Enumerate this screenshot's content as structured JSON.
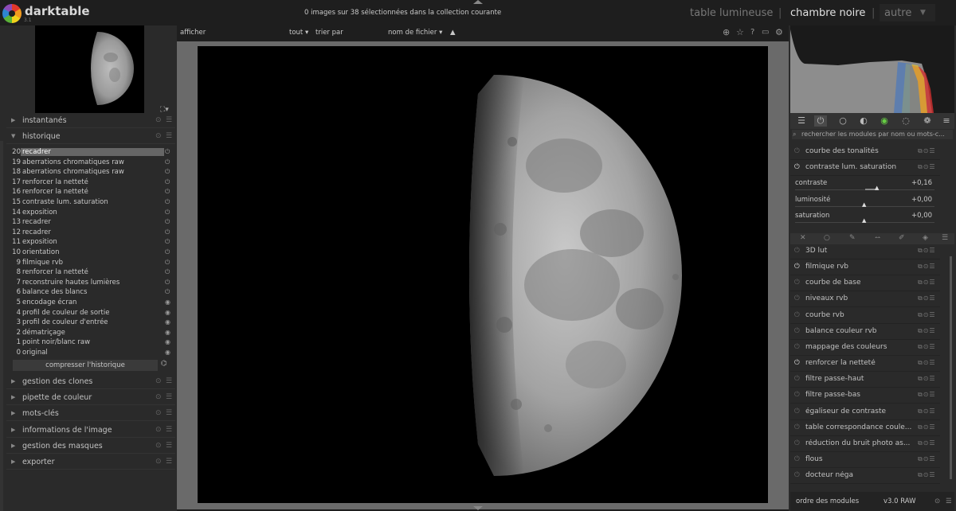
{
  "app": {
    "name": "darktable",
    "version": "3.1"
  },
  "header": {
    "collection_info": "0 images sur 38 sélectionnées dans la collection courante",
    "views": {
      "lighttable": "table lumineuse",
      "darkroom": "chambre noire",
      "other": "autre",
      "separator": "|"
    }
  },
  "left": {
    "sections_top": [
      {
        "label": "instantanés",
        "arrow": "▶"
      },
      {
        "label": "historique",
        "arrow": "▼"
      }
    ],
    "history": [
      {
        "num": "20",
        "name": "recadrer",
        "active": true
      },
      {
        "num": "19",
        "name": "aberrations chromatiques raw"
      },
      {
        "num": "18",
        "name": "aberrations chromatiques raw"
      },
      {
        "num": "17",
        "name": "renforcer la netteté"
      },
      {
        "num": "16",
        "name": "renforcer la netteté"
      },
      {
        "num": "15",
        "name": "contraste lum. saturation"
      },
      {
        "num": "14",
        "name": "exposition"
      },
      {
        "num": "13",
        "name": "recadrer"
      },
      {
        "num": "12",
        "name": "recadrer"
      },
      {
        "num": "11",
        "name": "exposition"
      },
      {
        "num": "10",
        "name": "orientation"
      },
      {
        "num": "9",
        "name": "filmique rvb"
      },
      {
        "num": "8",
        "name": "renforcer la netteté"
      },
      {
        "num": "7",
        "name": "reconstruire hautes lumières"
      },
      {
        "num": "6",
        "name": "balance des blancs"
      },
      {
        "num": "5",
        "name": "encodage écran"
      },
      {
        "num": "4",
        "name": "profil de couleur de sortie"
      },
      {
        "num": "3",
        "name": "profil de couleur d'entrée"
      },
      {
        "num": "2",
        "name": "dématriçage"
      },
      {
        "num": "1",
        "name": "point noir/blanc raw"
      },
      {
        "num": "0",
        "name": "original"
      }
    ],
    "compress_label": "compresser l'historique",
    "sections_bottom": [
      {
        "label": "gestion des clones"
      },
      {
        "label": "pipette de couleur"
      },
      {
        "label": "mots-clés"
      },
      {
        "label": "informations de l'image"
      },
      {
        "label": "gestion des masques"
      },
      {
        "label": "exporter"
      }
    ]
  },
  "center": {
    "toolbar": {
      "display": "afficher",
      "filter": "tout",
      "sort_label": "trier par",
      "sort_value": "nom de fichier",
      "sort_dir": "▲"
    }
  },
  "right": {
    "search_placeholder": "rechercher les modules par nom ou mots-c...",
    "top_modules": [
      {
        "name": "courbe des tonalités",
        "on": false
      },
      {
        "name": "contraste lum. saturation",
        "on": true
      }
    ],
    "params": [
      {
        "label": "contraste",
        "value": "+0,16",
        "level": 0.16
      },
      {
        "label": "luminosité",
        "value": "+0,00",
        "level": 0
      },
      {
        "label": "saturation",
        "value": "+0,00",
        "level": 0
      }
    ],
    "modules": [
      {
        "name": "3D lut",
        "on": false
      },
      {
        "name": "filmique rvb",
        "on": true
      },
      {
        "name": "courbe de base",
        "on": false
      },
      {
        "name": "niveaux rvb",
        "on": false
      },
      {
        "name": "courbe rvb",
        "on": false
      },
      {
        "name": "balance couleur rvb",
        "on": false
      },
      {
        "name": "mappage des couleurs",
        "on": false
      },
      {
        "name": "renforcer la netteté",
        "on": true
      },
      {
        "name": "filtre passe-haut",
        "on": false
      },
      {
        "name": "filtre passe-bas",
        "on": false
      },
      {
        "name": "égaliseur de contraste",
        "on": false
      },
      {
        "name": "table correspondance coule...",
        "on": false
      },
      {
        "name": "réduction du bruit photo as...",
        "on": false
      },
      {
        "name": "flous",
        "on": false
      },
      {
        "name": "docteur néga",
        "on": false
      }
    ],
    "footer": {
      "order": "ordre des modules",
      "version": "v3.0 RAW"
    }
  },
  "colors": {
    "accent": "#e2e2e2",
    "panel": "#2a2a2a",
    "background": "#1e1e1e"
  }
}
